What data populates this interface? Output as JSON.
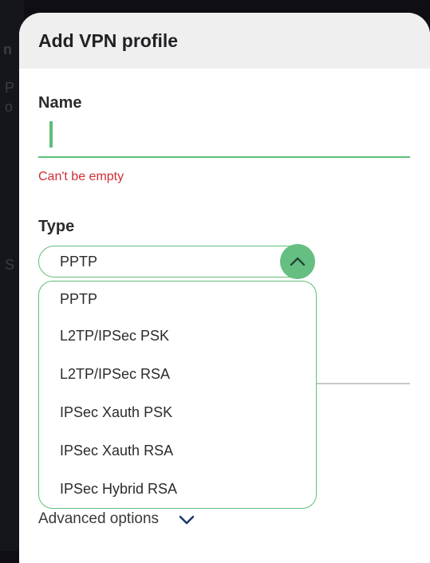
{
  "dialog": {
    "title": "Add VPN profile"
  },
  "name_field": {
    "label": "Name",
    "value": "",
    "error": "Can't be empty"
  },
  "type_field": {
    "label": "Type",
    "selected": "PPTP",
    "options": [
      "PPTP",
      "L2TP/IPSec PSK",
      "L2TP/IPSec RSA",
      "IPSec Xauth PSK",
      "IPSec Xauth RSA",
      "IPSec Hybrid RSA"
    ]
  },
  "advanced": {
    "label": "Advanced options",
    "icon": "chevron-down-icon"
  },
  "colors": {
    "accent": "#5fbe7a",
    "error": "#cf2d35",
    "header_bg": "#efefef"
  }
}
